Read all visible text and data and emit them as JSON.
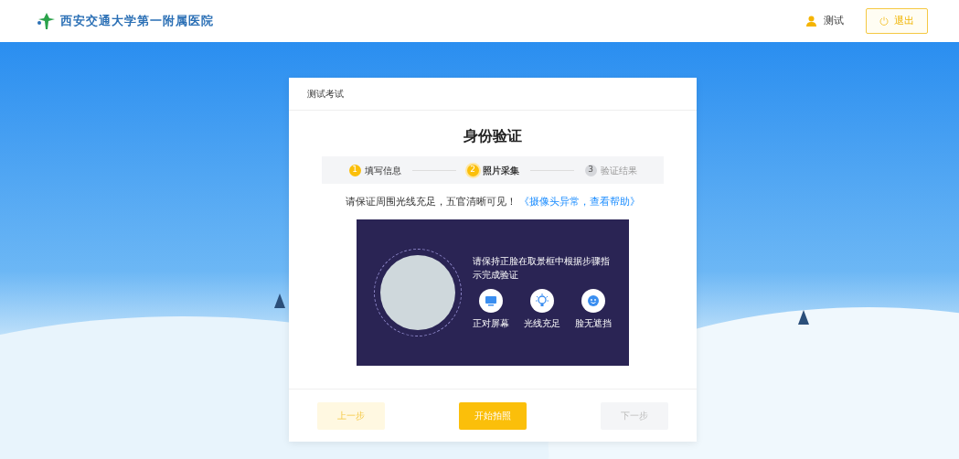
{
  "header": {
    "logo_text": "西安交通大学第一附属医院",
    "user_name": "测试",
    "logout_label": "退出"
  },
  "card": {
    "title": "测试考试",
    "heading": "身份验证",
    "steps": [
      {
        "number": "1",
        "label": "填写信息",
        "completed": true,
        "selected": false
      },
      {
        "number": "2",
        "label": "照片采集",
        "completed": false,
        "selected": true
      },
      {
        "number": "3",
        "label": "验证结果",
        "completed": false,
        "selected": false
      }
    ],
    "instruction": "请保证周围光线充足，五官清晰可见！",
    "help_link": "《摄像头异常，查看帮助》",
    "camera_panel": {
      "hint": "请保持正脸在取景框中根据步骤指示完成验证",
      "tips": [
        {
          "kind": "screen",
          "label": "正对屏幕"
        },
        {
          "kind": "light",
          "label": "光线充足"
        },
        {
          "kind": "face",
          "label": "脸无遮挡"
        }
      ]
    },
    "buttons": [
      {
        "label": "上一步",
        "kind": "prev",
        "disabled": true
      },
      {
        "label": "开始拍照",
        "kind": "primary",
        "disabled": false
      },
      {
        "label": "下一步",
        "kind": "next",
        "disabled": true
      }
    ]
  }
}
